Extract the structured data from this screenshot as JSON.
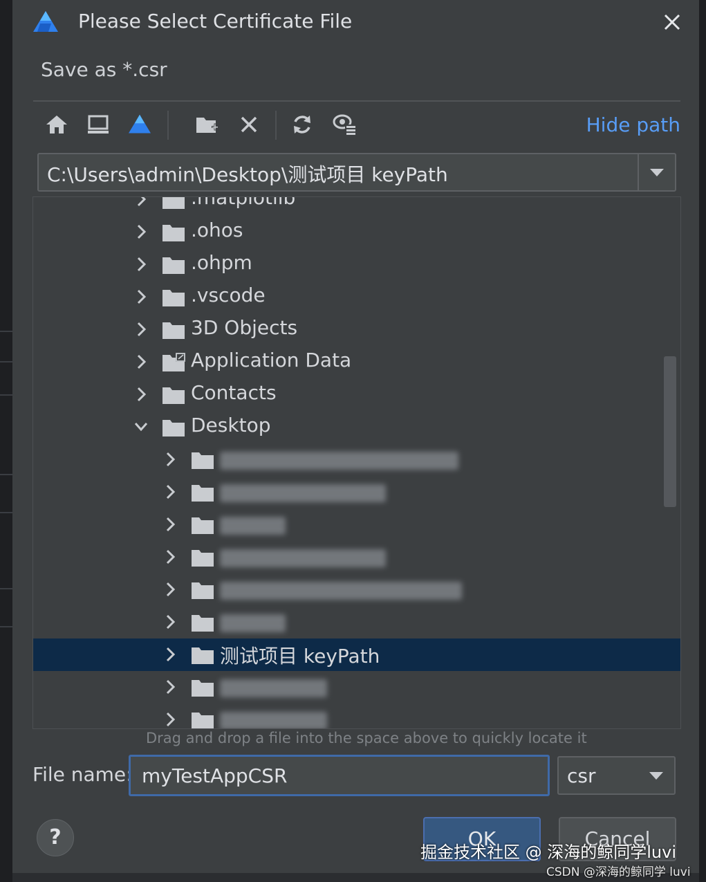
{
  "dialog": {
    "title": "Please Select Certificate File",
    "subtitle": "Save as *.csr",
    "close_icon": "close-icon",
    "logo_icon": "deveco-logo-icon"
  },
  "toolbar": {
    "icons": [
      "home-icon",
      "desktop-icon",
      "project-icon",
      "new-folder-icon",
      "delete-icon",
      "refresh-icon",
      "show-hidden-icon"
    ],
    "hide_path_label": "Hide path"
  },
  "path": {
    "value": "C:\\Users\\admin\\Desktop\\测试项目 keyPath"
  },
  "tree": {
    "items": [
      {
        "label": ".matplotlib",
        "level": 1,
        "expanded": false
      },
      {
        "label": ".ohos",
        "level": 1,
        "expanded": false
      },
      {
        "label": ".ohpm",
        "level": 1,
        "expanded": false
      },
      {
        "label": ".vscode",
        "level": 1,
        "expanded": false
      },
      {
        "label": "3D Objects",
        "level": 1,
        "expanded": false
      },
      {
        "label": "Application Data",
        "level": 1,
        "expanded": false,
        "shortcut": true
      },
      {
        "label": "Contacts",
        "level": 1,
        "expanded": false
      },
      {
        "label": "Desktop",
        "level": 1,
        "expanded": true
      },
      {
        "label": "",
        "level": 2,
        "expanded": false,
        "blurred": true
      },
      {
        "label": "",
        "level": 2,
        "expanded": false,
        "blurred": true
      },
      {
        "label": "",
        "level": 2,
        "expanded": false,
        "blurred": true
      },
      {
        "label": "",
        "level": 2,
        "expanded": false,
        "blurred": true
      },
      {
        "label": "",
        "level": 2,
        "expanded": false,
        "blurred": true
      },
      {
        "label": "",
        "level": 2,
        "expanded": false,
        "blurred": true
      },
      {
        "label": "测试项目 keyPath",
        "level": 2,
        "expanded": false,
        "selected": true
      },
      {
        "label": "",
        "level": 2,
        "expanded": false,
        "blurred": true
      },
      {
        "label": "",
        "level": 2,
        "expanded": false,
        "blurred": true
      }
    ]
  },
  "hint": "Drag and drop a file into the space above to quickly locate it",
  "file_name": {
    "label": "File name:",
    "value": "myTestAppCSR"
  },
  "extension": {
    "selected": "csr"
  },
  "buttons": {
    "help": "?",
    "ok": "OK",
    "cancel": "Cancel"
  },
  "watermark": {
    "line1": "掘金技术社区 @ 深海的鲸同学luvi",
    "line2": "CSDN @深海的鲸同学 luvi"
  },
  "colors": {
    "accent": "#589df6",
    "selection": "#0d2a48",
    "ok_button": "#365880"
  }
}
